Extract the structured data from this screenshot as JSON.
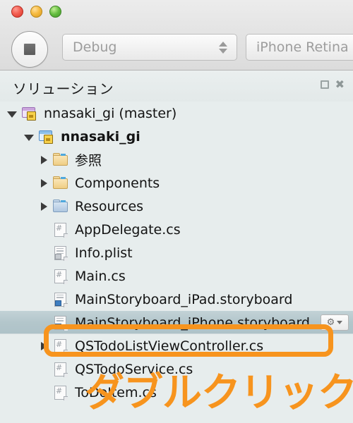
{
  "window": {
    "traffic_lights": [
      {
        "name": "close",
        "color": "#f35f52"
      },
      {
        "name": "minimize",
        "color": "#f6bb42"
      },
      {
        "name": "maximize",
        "color": "#63bd3f"
      }
    ]
  },
  "toolbar": {
    "stop_button": "stop-icon",
    "configuration": {
      "value": "Debug",
      "icon": "stepper-icon"
    },
    "device": {
      "value": "iPhone Retina (",
      "icon": "stepper-icon"
    }
  },
  "panel": {
    "title": "ソリューション",
    "pin_icon": "pin-icon",
    "close_icon": "close-icon"
  },
  "tree": [
    {
      "label": "nnasaki_gi (master)",
      "icon": "solution-icon",
      "indent": 0,
      "arrow": "open",
      "bold": false,
      "selected": false
    },
    {
      "label": "nnasaki_gi",
      "icon": "project-icon",
      "indent": 1,
      "arrow": "open",
      "bold": true,
      "selected": false
    },
    {
      "label": "参照",
      "icon": "folder-tan-icon",
      "indent": 2,
      "arrow": "closed",
      "bold": false,
      "selected": false
    },
    {
      "label": "Components",
      "icon": "folder-tan-icon",
      "indent": 2,
      "arrow": "closed",
      "bold": false,
      "selected": false
    },
    {
      "label": "Resources",
      "icon": "folder-blue-icon",
      "indent": 2,
      "arrow": "closed",
      "bold": false,
      "selected": false
    },
    {
      "label": "AppDelegate.cs",
      "icon": "csharp-file-icon",
      "indent": 2,
      "arrow": "none",
      "bold": false,
      "selected": false
    },
    {
      "label": "Info.plist",
      "icon": "plist-file-icon",
      "indent": 2,
      "arrow": "none",
      "bold": false,
      "selected": false
    },
    {
      "label": "Main.cs",
      "icon": "csharp-file-icon",
      "indent": 2,
      "arrow": "none",
      "bold": false,
      "selected": false
    },
    {
      "label": "MainStoryboard_iPad.storyboard",
      "icon": "storyboard-file-icon",
      "indent": 2,
      "arrow": "none",
      "bold": false,
      "selected": false
    },
    {
      "label": "MainStoryboard_iPhone.storyboard",
      "icon": "storyboard-file-icon",
      "indent": 2,
      "arrow": "none",
      "bold": false,
      "selected": true
    },
    {
      "label": "QSTodoListViewController.cs",
      "icon": "csharp-file-icon",
      "indent": 2,
      "arrow": "closed",
      "bold": false,
      "selected": false
    },
    {
      "label": "QSTodoService.cs",
      "icon": "csharp-file-icon",
      "indent": 2,
      "arrow": "none",
      "bold": false,
      "selected": false
    },
    {
      "label": "ToDoItem.cs",
      "icon": "csharp-file-icon",
      "indent": 2,
      "arrow": "none",
      "bold": false,
      "selected": false
    }
  ],
  "selected_row_actions": {
    "gear_label": "⚙",
    "caret": "caret-down-icon"
  },
  "annotation": {
    "text": "ダブルクリック",
    "color": "#f7941e",
    "outline": "#1a1a1a",
    "highlight_target": "MainStoryboard_iPhone.storyboard"
  }
}
